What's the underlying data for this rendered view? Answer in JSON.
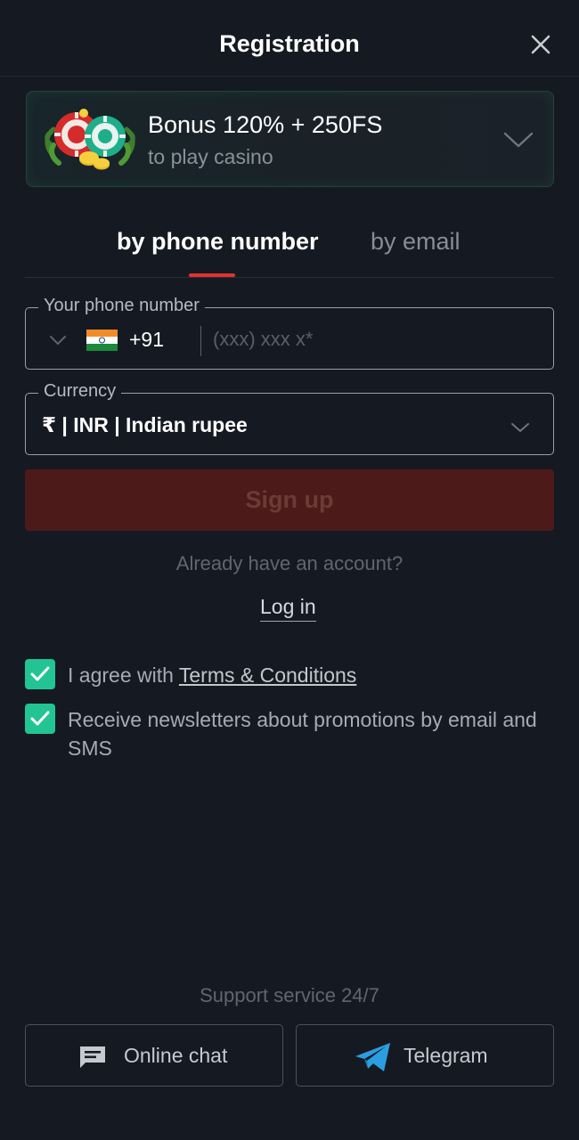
{
  "header": {
    "title": "Registration",
    "close_icon": "close-icon"
  },
  "bonus": {
    "title": "Bonus 120% + 250FS",
    "subtitle": "to play casino",
    "art_icon": "casino-chips-icon",
    "chevron_icon": "chevron-down-icon"
  },
  "tabs": [
    {
      "label": "by phone number",
      "active": true
    },
    {
      "label": "by email",
      "active": false
    }
  ],
  "phone": {
    "legend": "Your phone number",
    "flag_icon": "india-flag-icon",
    "dial_code": "+91",
    "placeholder": "(xxx) xxx x*",
    "value": ""
  },
  "currency": {
    "legend": "Currency",
    "value": "₹ | INR | Indian rupee"
  },
  "signup": {
    "label": "Sign up"
  },
  "account": {
    "prompt": "Already have an account?",
    "login_label": "Log in"
  },
  "consents": [
    {
      "text": "I agree with ",
      "link": "Terms & Conditions",
      "checked": true
    },
    {
      "text": "Receive newsletters about promotions by email and SMS",
      "checked": true
    }
  ],
  "support": {
    "title": "Support service 24/7",
    "buttons": [
      {
        "label": "Online chat",
        "icon": "chat-icon"
      },
      {
        "label": "Telegram",
        "icon": "telegram-icon"
      }
    ]
  },
  "colors": {
    "background": "#151a22",
    "accent_red": "#e4322b",
    "signup_bg": "#4b1a19",
    "check_green": "#23c493"
  }
}
